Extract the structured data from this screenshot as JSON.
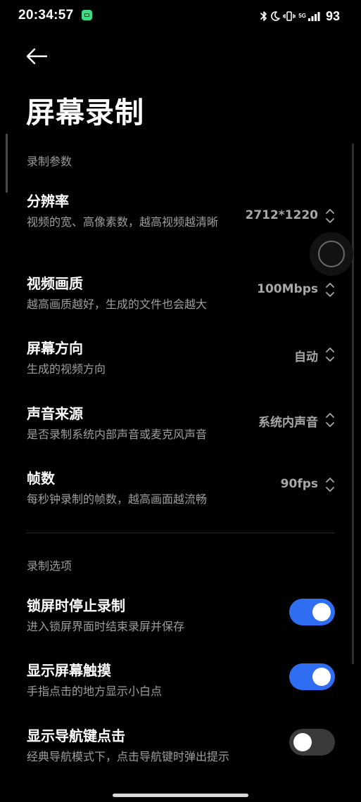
{
  "status_bar": {
    "time": "20:34:57",
    "network": "5G",
    "battery": "93"
  },
  "page": {
    "title": "屏幕录制"
  },
  "sections": {
    "params_header": "录制参数",
    "options_header": "录制选项"
  },
  "params": [
    {
      "title": "分辨率",
      "subtitle": "视频的宽、高像素数，越高视频越清晰",
      "value": "2712*1220"
    },
    {
      "title": "视频画质",
      "subtitle": "越高画质越好，生成的文件也会越大",
      "value": "100Mbps"
    },
    {
      "title": "屏幕方向",
      "subtitle": "生成的视频方向",
      "value": "自动"
    },
    {
      "title": "声音来源",
      "subtitle": "是否录制系统内部声音或麦克风声音",
      "value": "系统内声音"
    },
    {
      "title": "帧数",
      "subtitle": "每秒钟录制的帧数，越高画面越流畅",
      "value": "90fps"
    }
  ],
  "options": [
    {
      "title": "锁屏时停止录制",
      "subtitle": "进入锁屏界面时结束录屏并保存",
      "enabled": true
    },
    {
      "title": "显示屏幕触摸",
      "subtitle": "手指点击的地方显示小白点",
      "enabled": true
    },
    {
      "title": "显示导航键点击",
      "subtitle": "经典导航模式下，点击导航键时弹出提示",
      "enabled": false
    }
  ],
  "colors": {
    "background": "#000000",
    "accent": "#2f6ef2",
    "secondary_text": "#9e9e9e"
  }
}
